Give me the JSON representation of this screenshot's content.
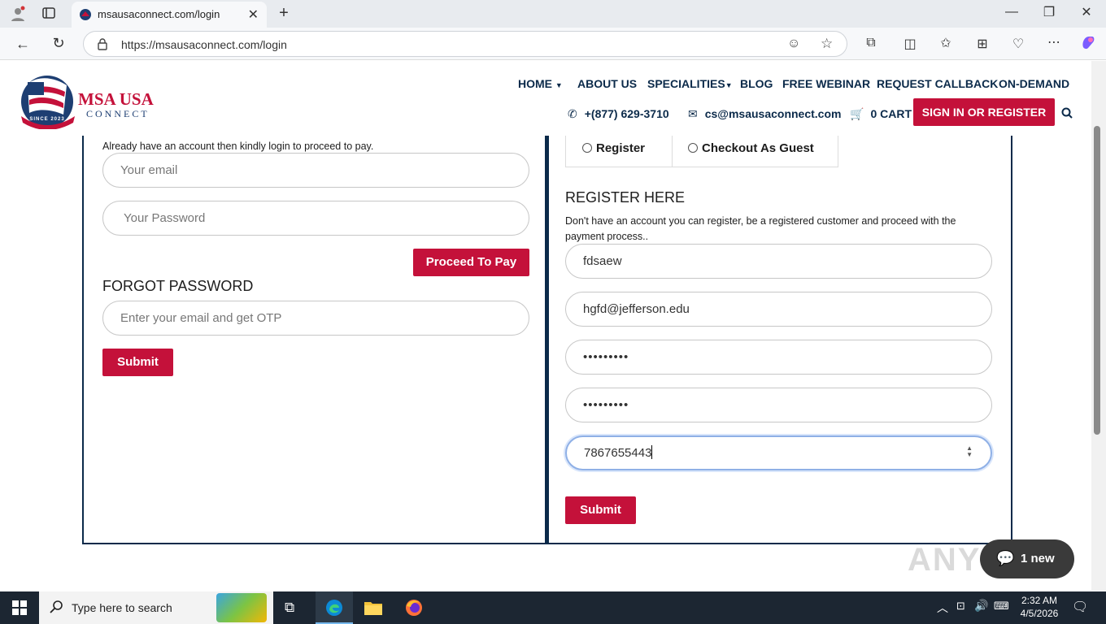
{
  "browser": {
    "tab_title": "msausaconnect.com/login",
    "url": "https://msausaconnect.com/login"
  },
  "logo": {
    "line1": "MSA USA",
    "line2": "CONNECT",
    "since": "SINCE 2023"
  },
  "nav": {
    "items": [
      "HOME",
      "ABOUT US",
      "SPECIALITIES",
      "BLOG",
      "FREE WEBINAR",
      "REQUEST CALLBACK",
      "ON-DEMAND"
    ],
    "phone": "+(877) 629-3710",
    "email": "cs@msausaconnect.com",
    "cart": "0 CART",
    "signin": "SIGN IN OR REGISTER"
  },
  "login": {
    "intro": "Already have an account then kindly login to proceed to pay.",
    "email_placeholder": "Your email",
    "password_placeholder": "Your Password",
    "proceed": "Proceed To Pay",
    "forgot_heading": "FORGOT PASSWORD",
    "otp_placeholder": "Enter your email and get OTP",
    "submit": "Submit"
  },
  "register": {
    "option_register": "Register",
    "option_guest": "Checkout As Guest",
    "heading": "REGISTER HERE",
    "description": "Don't have an account you can register, be a registered customer and proceed with the payment process..",
    "name_value": "fdsaew",
    "email_value": "hgfd@jefferson.edu",
    "password_value": "•••••••••",
    "confirm_value": "•••••••••",
    "phone_value": "7867655443",
    "submit": "Submit"
  },
  "chat_badge": "1 new",
  "watermark": "ANY RUN",
  "taskbar": {
    "search_placeholder": "Type here to search",
    "time": "2:32 AM",
    "date": "4/5/2026"
  },
  "colors": {
    "brand_red": "#c4113a",
    "navy": "#0b2a4a",
    "taskbar": "#1c2632"
  }
}
